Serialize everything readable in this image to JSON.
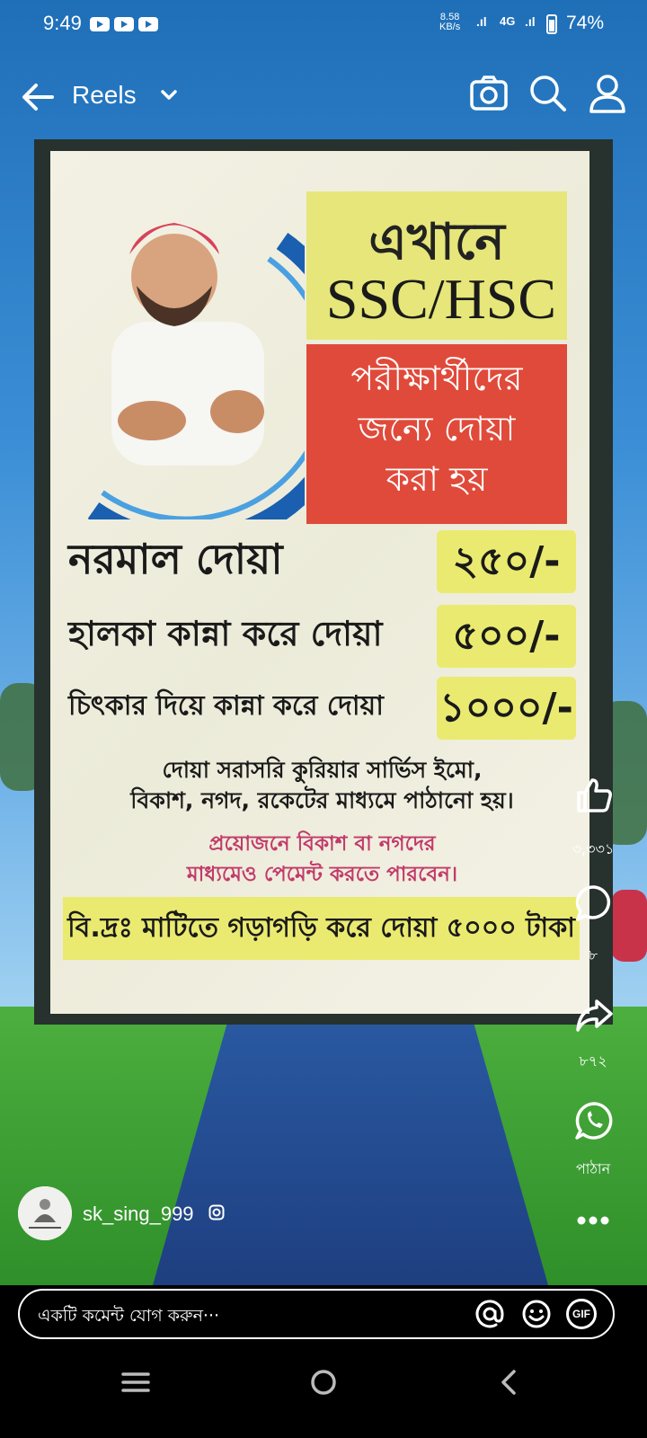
{
  "status_bar": {
    "time": "9:49",
    "net_speed_top": "8.58",
    "net_speed_bottom": "KB/s",
    "network_label": "4G",
    "battery": "74%",
    "battery_fraction": 0.74
  },
  "top_bar": {
    "title": "Reels",
    "icons": [
      "back-arrow-icon",
      "chevron-down-icon",
      "camera-icon",
      "search-icon",
      "profile-icon"
    ]
  },
  "banner": {
    "heading_1": "এখানে",
    "heading_2": "SSC/HSC",
    "subheading_lines": [
      "পরীক্ষার্থীদের",
      "জন্যে দোয়া",
      "করা হয়"
    ],
    "items": [
      {
        "label": "নরমাল দোয়া",
        "price": "২৫০/-"
      },
      {
        "label": "হালকা কান্না করে দোয়া",
        "price": "৫০০/-"
      },
      {
        "label": "চিৎকার দিয়ে কান্না করে দোয়া",
        "price": "১০০০/-"
      }
    ],
    "note_lines": [
      "দোয়া সরাসরি কুরিয়ার সার্ভিস ইমো,",
      "বিকাশ, নগদ, রকেটের মাধ্যমে পাঠানো হয়।"
    ],
    "payment_lines": [
      "প্রয়োজনে বিকাশ বা নগদের",
      "মাধ্যমেও পেমেন্ট করতে পারবেন।"
    ],
    "footer": "বি.দ্রঃ মাটিতে গড়াগড়ি করে দোয়া ৫০০০ টাকা"
  },
  "actions": {
    "likes": "৩,৩৩১",
    "comments": "৮",
    "shares": "৮৭২",
    "send_label": "পাঠান"
  },
  "author": {
    "username": "sk_sing_999"
  },
  "comment_bar": {
    "placeholder": "একটি কমেন্ট যোগ করুন···",
    "gif_label": "GIF"
  },
  "colors": {
    "sky": "#3c8fd6",
    "banner_yellow": "#e6e67a",
    "banner_red": "#e04a3a",
    "price_yellow": "#eaea70"
  }
}
